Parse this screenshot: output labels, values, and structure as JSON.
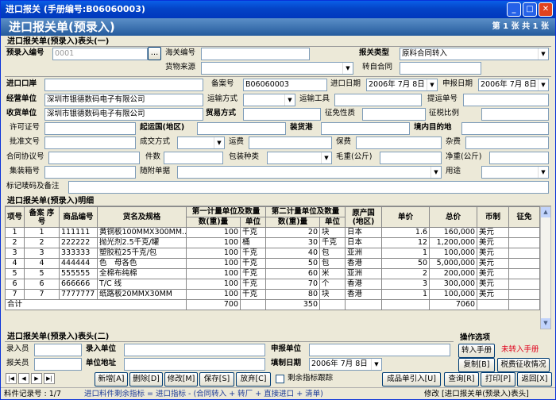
{
  "window": {
    "title": "进口报关 (手册编号:B06060003)"
  },
  "banner": {
    "title": "进口报关单(预录入)",
    "page": "第 1 张 共 1 张"
  },
  "header_section": {
    "title": "进口报关单(预录入)表头(一)"
  },
  "form": {
    "pre_no_label": "预录入编号",
    "pre_no": "0001",
    "sea_no_label": "海关编号",
    "decl_type_label": "报关类型",
    "decl_type": "原料合同转入",
    "goods_src_label": "货物来源",
    "transfer_label": "转自合同",
    "port_label": "进口口岸",
    "record_no_label": "备案号",
    "record_no": "B06060003",
    "import_date_label": "进口日期",
    "import_date": "2006年 7月 8日",
    "apply_date_label": "申报日期",
    "apply_date": "2006年 7月 8日",
    "operator_label": "经营单位",
    "operator": "深圳市银德数码电子有限公司",
    "transport_label": "运输方式",
    "vehicle_label": "运输工具",
    "bl_label": "提运单号",
    "receiver_label": "收货单位",
    "receiver": "深圳市银德数码电子有限公司",
    "trade_label": "贸易方式",
    "tax_nature_label": "征免性质",
    "tax_ratio_label": "征税比例",
    "license_label": "许可证号",
    "origin_country_label": "起运国(地区)",
    "port_loading_label": "装货港",
    "dest_label": "境内目的地",
    "approval_label": "批准文号",
    "deal_label": "成交方式",
    "freight_label": "运费",
    "insurance_label": "保费",
    "misc_label": "杂费",
    "contract_label": "合同协议号",
    "pieces_label": "件数",
    "package_label": "包装种类",
    "gross_label": "毛重(公斤)",
    "net_label": "净重(公斤)",
    "container_label": "集装箱号",
    "docs_label": "随附单据",
    "use_label": "用途",
    "mark_label": "标记唛码及备注"
  },
  "detail_section": {
    "title": "进口报关单(预录入)明细"
  },
  "grid": {
    "headers": {
      "item": "项号",
      "seq": "备案\n序号",
      "code": "商品编号",
      "name": "货名及规格",
      "unit1_group": "第一计量单位及数量",
      "unit2_group": "第二计量单位及数量",
      "origin": "原产国(地区)",
      "price": "单价",
      "total": "总价",
      "currency": "币制",
      "tax": "征免",
      "qty": "数(重)量",
      "unit": "单位"
    },
    "rows": [
      {
        "item": "1",
        "seq": "1",
        "code": "111111",
        "name": "黄铜板100MMX300MM...",
        "q1": "100",
        "u1": "千克",
        "q2": "20",
        "u2": "块",
        "origin": "日本",
        "price": "1.6",
        "total": "160,000",
        "cur": "美元"
      },
      {
        "item": "2",
        "seq": "2",
        "code": "222222",
        "name": "抛光剂2.5千克/罐",
        "q1": "100",
        "u1": "桶",
        "q2": "30",
        "u2": "千克",
        "origin": "日本",
        "price": "12",
        "total": "1,200,000",
        "cur": "美元"
      },
      {
        "item": "3",
        "seq": "3",
        "code": "333333",
        "name": "塑胶粒25千克/包",
        "q1": "100",
        "u1": "千克",
        "q2": "40",
        "u2": "包",
        "origin": "亚洲",
        "price": "1",
        "total": "100,000",
        "cur": "美元"
      },
      {
        "item": "4",
        "seq": "4",
        "code": "444444",
        "name": "色　母各色",
        "q1": "100",
        "u1": "千克",
        "q2": "50",
        "u2": "包",
        "origin": "香港",
        "price": "50",
        "total": "5,000,000",
        "cur": "美元"
      },
      {
        "item": "5",
        "seq": "5",
        "code": "555555",
        "name": "全棉布纯棉",
        "q1": "100",
        "u1": "千克",
        "q2": "60",
        "u2": "米",
        "origin": "亚洲",
        "price": "2",
        "total": "200,000",
        "cur": "美元"
      },
      {
        "item": "6",
        "seq": "6",
        "code": "666666",
        "name": "T/C 线",
        "q1": "100",
        "u1": "千克",
        "q2": "70",
        "u2": "个",
        "origin": "香港",
        "price": "3",
        "total": "300,000",
        "cur": "美元"
      },
      {
        "item": "7",
        "seq": "7",
        "code": "7777777",
        "name": "纸路板20MMX30MM",
        "q1": "100",
        "u1": "千克",
        "q2": "80",
        "u2": "块",
        "origin": "香港",
        "price": "1",
        "total": "100,000",
        "cur": "美元"
      }
    ],
    "total_label": "合计",
    "total_q1": "700",
    "total_q2": "350",
    "total_amount": "7060"
  },
  "footer_section": {
    "title": "进口报关单(预录入)表头(二)"
  },
  "footer": {
    "entry_label": "录入员",
    "entry_unit_label": "录入单位",
    "apply_unit_label": "申报单位",
    "apply_person_label": "报关员",
    "unit_addr_label": "单位地址",
    "fill_date_label": "填制日期",
    "fill_date": "2006年 7月 8日"
  },
  "ops": {
    "title": "操作选项",
    "to_manual": "转入手册",
    "not_transferred": "未转入手册",
    "copy": "复制[B]",
    "tax_info": "税费征收情况"
  },
  "toolbar": {
    "add": "新增[A]",
    "delete": "删除[D]",
    "modify": "修改[M]",
    "save": "保存[S]",
    "discard": "放弃[C]",
    "track": "剩余指标跟踪",
    "import": "成品单引入[U]",
    "query": "查询[R]",
    "print": "打印[P]",
    "back": "返回[X]"
  },
  "status": {
    "record": "料件记录号 : 1/7",
    "indicator": "进口料件剩余指标 = 进口指标 - (合同转入 + 转厂 + 直接进口 + 清单)",
    "mode": "修改 [进口报关单(预录入)表头]"
  },
  "colors": {
    "title_bg": "#0444C7",
    "banner_bg": "#245A9C",
    "accent_red": "#E0001B"
  }
}
